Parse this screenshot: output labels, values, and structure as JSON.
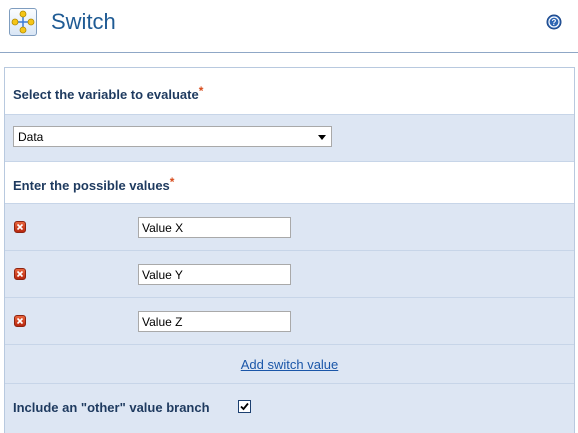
{
  "header": {
    "title": "Switch",
    "app_icon": "switch-workflow-icon",
    "help_icon": "help-icon"
  },
  "form": {
    "variable_section_label": "Select the variable to evaluate",
    "required_marker": "*",
    "variable_select_value": "Data",
    "values_section_label": "Enter the possible values",
    "values": [
      {
        "value": "Value X"
      },
      {
        "value": "Value Y"
      },
      {
        "value": "Value Z"
      }
    ],
    "add_value_link": "Add switch value",
    "other_branch_label": "Include an \"other\" value branch",
    "other_branch_checked": true
  },
  "colors": {
    "title": "#1f5b94",
    "label": "#1e3a5f",
    "required": "#d84c1c",
    "link": "#1a56a8",
    "row_blue": "#dde6f3",
    "delete_icon": "#c9391a"
  }
}
